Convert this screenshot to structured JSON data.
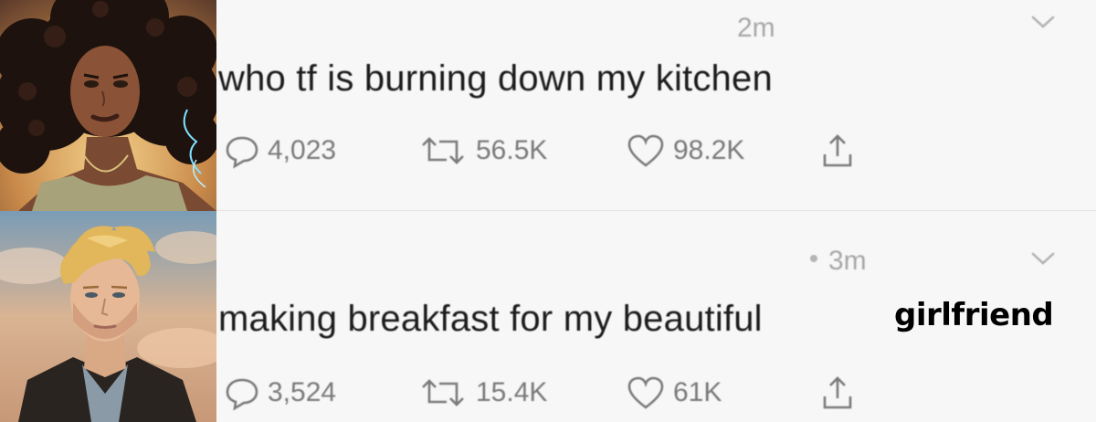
{
  "tweets": [
    {
      "time": "2m",
      "text": "who tf is burning down my kitchen",
      "replies": "4,023",
      "retweets": "56.5K",
      "likes": "98.2K",
      "has_dot": false,
      "avatar": "curly-haired-woman-portrait"
    },
    {
      "time": "3m",
      "text": "making breakfast for my beautiful",
      "highlight": "girlfriend",
      "replies": "3,524",
      "retweets": "15.4K",
      "likes": "61K",
      "has_dot": true,
      "avatar": "blond-man-portrait"
    }
  ],
  "colors": {
    "background": "#f7f7f7",
    "text": "#1c1c1c",
    "muted": "#7a7a7a",
    "divider": "#e3e3e3"
  }
}
